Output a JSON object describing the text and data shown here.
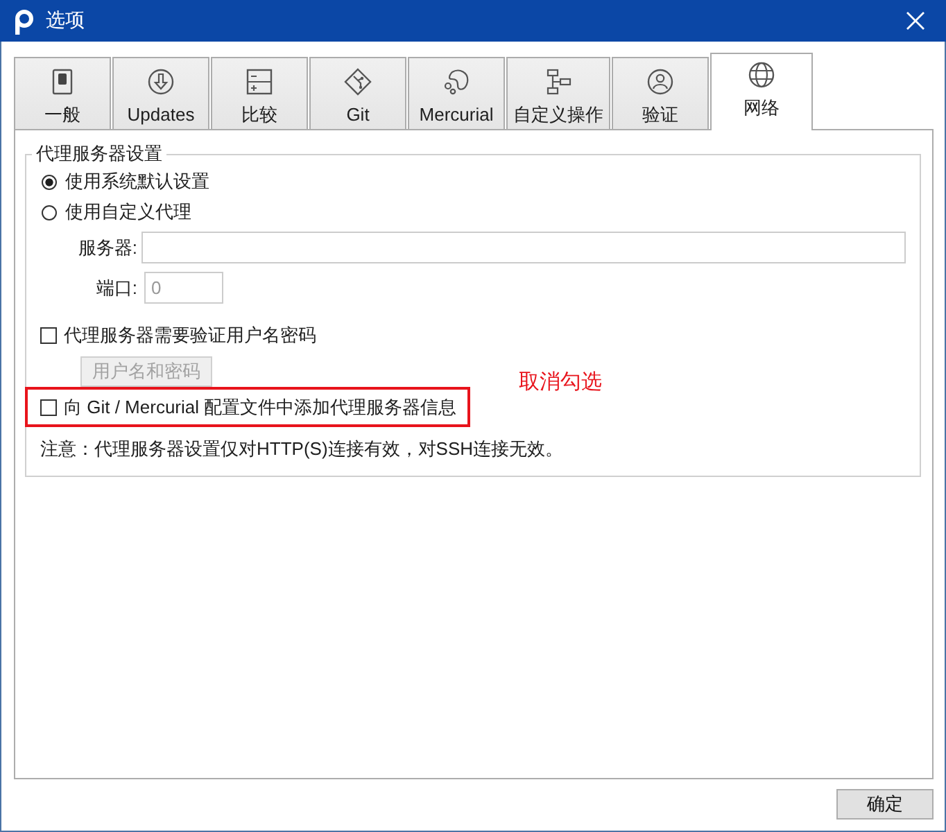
{
  "window": {
    "title": "选项"
  },
  "tabs": [
    {
      "label": "一般",
      "selected": false
    },
    {
      "label": "Updates",
      "selected": false
    },
    {
      "label": "比较",
      "selected": false
    },
    {
      "label": "Git",
      "selected": false
    },
    {
      "label": "Mercurial",
      "selected": false
    },
    {
      "label": "自定义操作",
      "selected": false
    },
    {
      "label": "验证",
      "selected": false
    },
    {
      "label": "网络",
      "selected": true
    }
  ],
  "proxy_group": {
    "title": "代理服务器设置",
    "options": [
      {
        "label": "使用系统默认设置",
        "selected": true
      },
      {
        "label": "使用自定义代理",
        "selected": false
      }
    ],
    "server": {
      "label": "服务器:",
      "disabled": true
    },
    "port": {
      "label": "端口:",
      "value": "0",
      "disabled": true
    },
    "auth_checkbox": {
      "label": "代理服务器需要验证用户名密码",
      "checked": false
    },
    "credentials_button": {
      "label": "用户名和密码",
      "disabled": true
    },
    "config_checkbox": {
      "label": "向 Git / Mercurial 配置文件中添加代理服务器信息",
      "checked": false,
      "highlighted": true
    },
    "note": "注意：代理服务器设置仅对HTTP(S)连接有效，对SSH连接无效。"
  },
  "annotation": {
    "text": "取消勾选"
  },
  "buttons": [
    {
      "label": "确定"
    }
  ]
}
